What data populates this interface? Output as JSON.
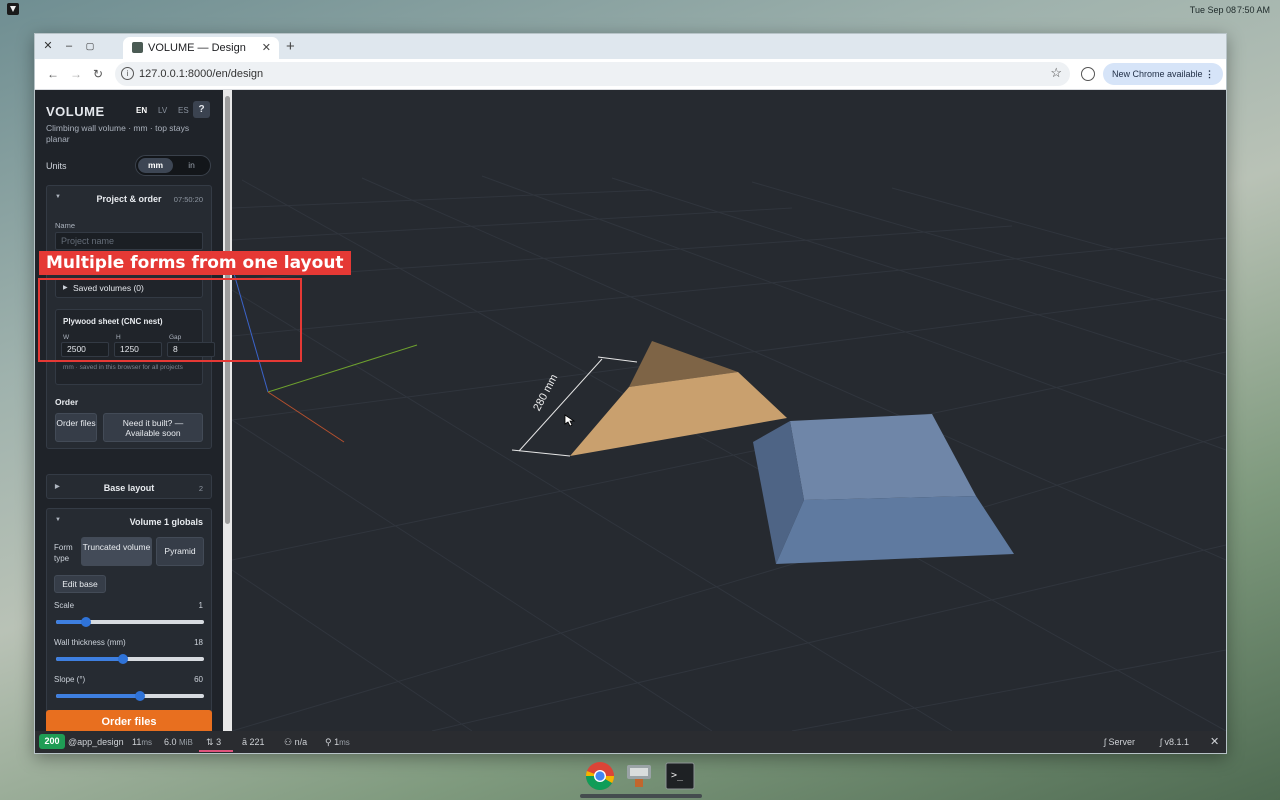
{
  "os": {
    "date": "Tue Sep 08",
    "time": "7:50 AM"
  },
  "browser": {
    "tab_title": "VOLUME — Design",
    "url": "127.0.0.1:8000/en/design",
    "update_button": "New Chrome available"
  },
  "sidebar": {
    "app_title": "VOLUME",
    "languages": [
      "EN",
      "LV",
      "ES"
    ],
    "help": "?",
    "subtitle": "Climbing wall volume · mm · top stays planar",
    "units_label": "Units",
    "units": {
      "mm": "mm",
      "in": "in",
      "selected": "mm"
    },
    "project": {
      "title": "Project & order",
      "time": "07:50:20",
      "name_label": "Name",
      "name_placeholder": "Project name",
      "saved_volumes": "Saved volumes (0)",
      "plywood": {
        "title": "Plywood sheet (CNC nest)",
        "w_label": "W",
        "w_value": "2500",
        "h_label": "H",
        "h_value": "1250",
        "gap_label": "Gap",
        "gap_value": "8",
        "note": "mm · saved in this browser for all projects"
      },
      "order_label": "Order",
      "order_files_btn": "Order files",
      "need_built_btn": "Need it built? — Available soon"
    },
    "base_layout": {
      "title": "Base layout",
      "count": "2"
    },
    "volume_globals": {
      "title": "Volume 1 globals",
      "form_type_label": "Form type",
      "form_types": [
        "Truncated volume",
        "Pyramid"
      ],
      "edit_base_btn": "Edit base",
      "sliders": [
        {
          "label": "Scale",
          "value": "1",
          "fraction": 0.2
        },
        {
          "label": "Wall thickness (mm)",
          "value": "18",
          "fraction": 0.45
        },
        {
          "label": "Slope (°)",
          "value": "60",
          "fraction": 0.57
        }
      ]
    },
    "order_files_cta": "Order files"
  },
  "viewport": {
    "dimension_label": "280 mm"
  },
  "debugbar": {
    "status": "200",
    "route": "@app_design",
    "time": "11",
    "time_unit": "ms",
    "memory": "6.0",
    "memory_unit": "MiB",
    "requests": "3",
    "translations": "221",
    "user": "n/a",
    "twig": "1",
    "twig_unit": "ms",
    "server": "Server",
    "version": "v8.1.1"
  },
  "annotation": {
    "label": "Multiple forms from one layout"
  },
  "colors": {
    "accent": "#e86f1f",
    "annotation": "#e53935",
    "status_ok": "#1f9d55",
    "slider": "#2f73d8"
  }
}
